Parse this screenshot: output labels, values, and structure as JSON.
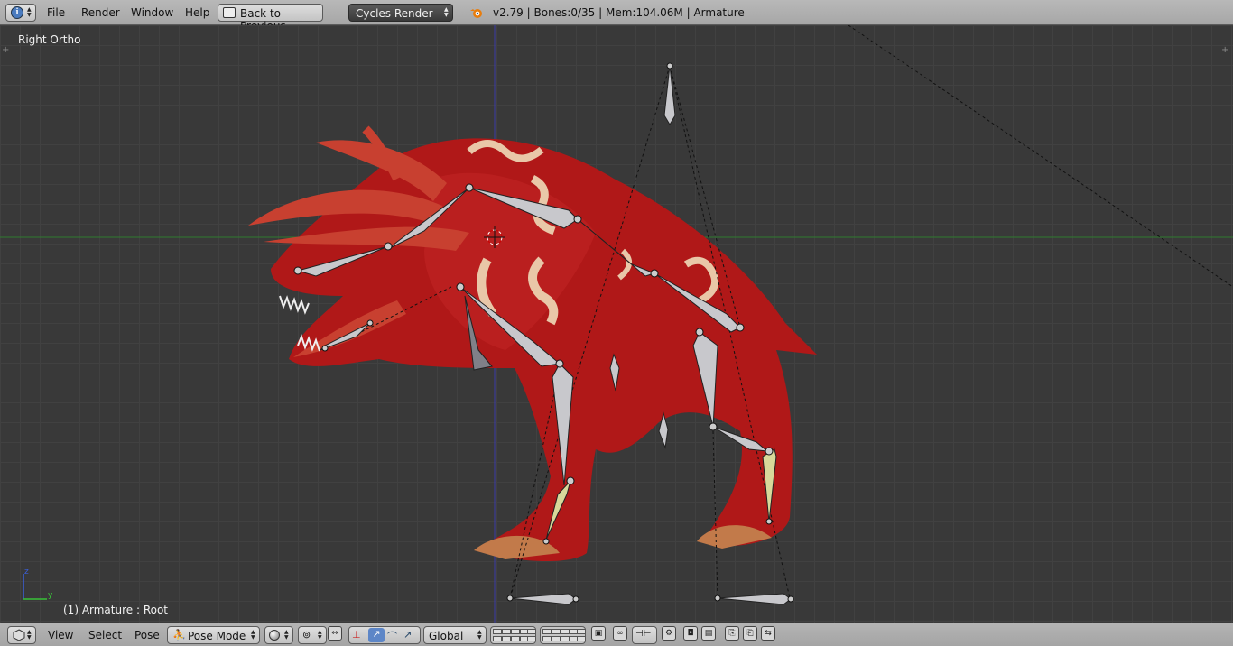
{
  "topbar": {
    "editor_type_icon": "info-icon",
    "menus": [
      "File",
      "Render",
      "Window",
      "Help"
    ],
    "back_button": "Back to Previous",
    "render_engine": "Cycles Render",
    "stats": "v2.79 | Bones:0/35  | Mem:104.06M | Armature"
  },
  "viewport": {
    "view_name": "Right Ortho",
    "object_info": "(1) Armature : Root",
    "axis_labels": {
      "z": "z",
      "y": "y"
    },
    "colors": {
      "background": "#393939",
      "grid": "#414141",
      "y_axis_line": "#2f7a2f",
      "z_axis_line": "#3a3aa8",
      "creature": "#b01818",
      "bone": "#c8c8cc",
      "bone_selected": "#d8d89a"
    }
  },
  "bottombar": {
    "view_menu": "View",
    "select_menu": "Select",
    "pose_menu": "Pose",
    "mode": "Pose Mode",
    "orientation": "Global",
    "icons": [
      "editor-type-icon",
      "viewport-shading-icon",
      "pivot-point-icon",
      "manipulator-icon",
      "translate-icon",
      "rotate-icon",
      "scale-icon",
      "layers-icon",
      "lock-icon",
      "onion-skin-icon",
      "copy-pose-icon",
      "paste-pose-icon",
      "paste-flipped-icon",
      "render-icon",
      "render-anim-icon"
    ]
  }
}
